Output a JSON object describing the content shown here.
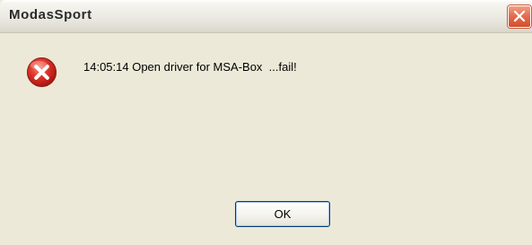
{
  "dialog": {
    "title": "ModasSport",
    "message": "14:05:14 Open driver for MSA-Box  ...fail!",
    "icon": "error-icon",
    "close_icon": "close-icon",
    "ok_label": "OK"
  },
  "colors": {
    "dialog_background": "#ece9d8",
    "close_button": "#e46e4f",
    "error_red": "#d8271c",
    "button_border": "#003c74"
  }
}
